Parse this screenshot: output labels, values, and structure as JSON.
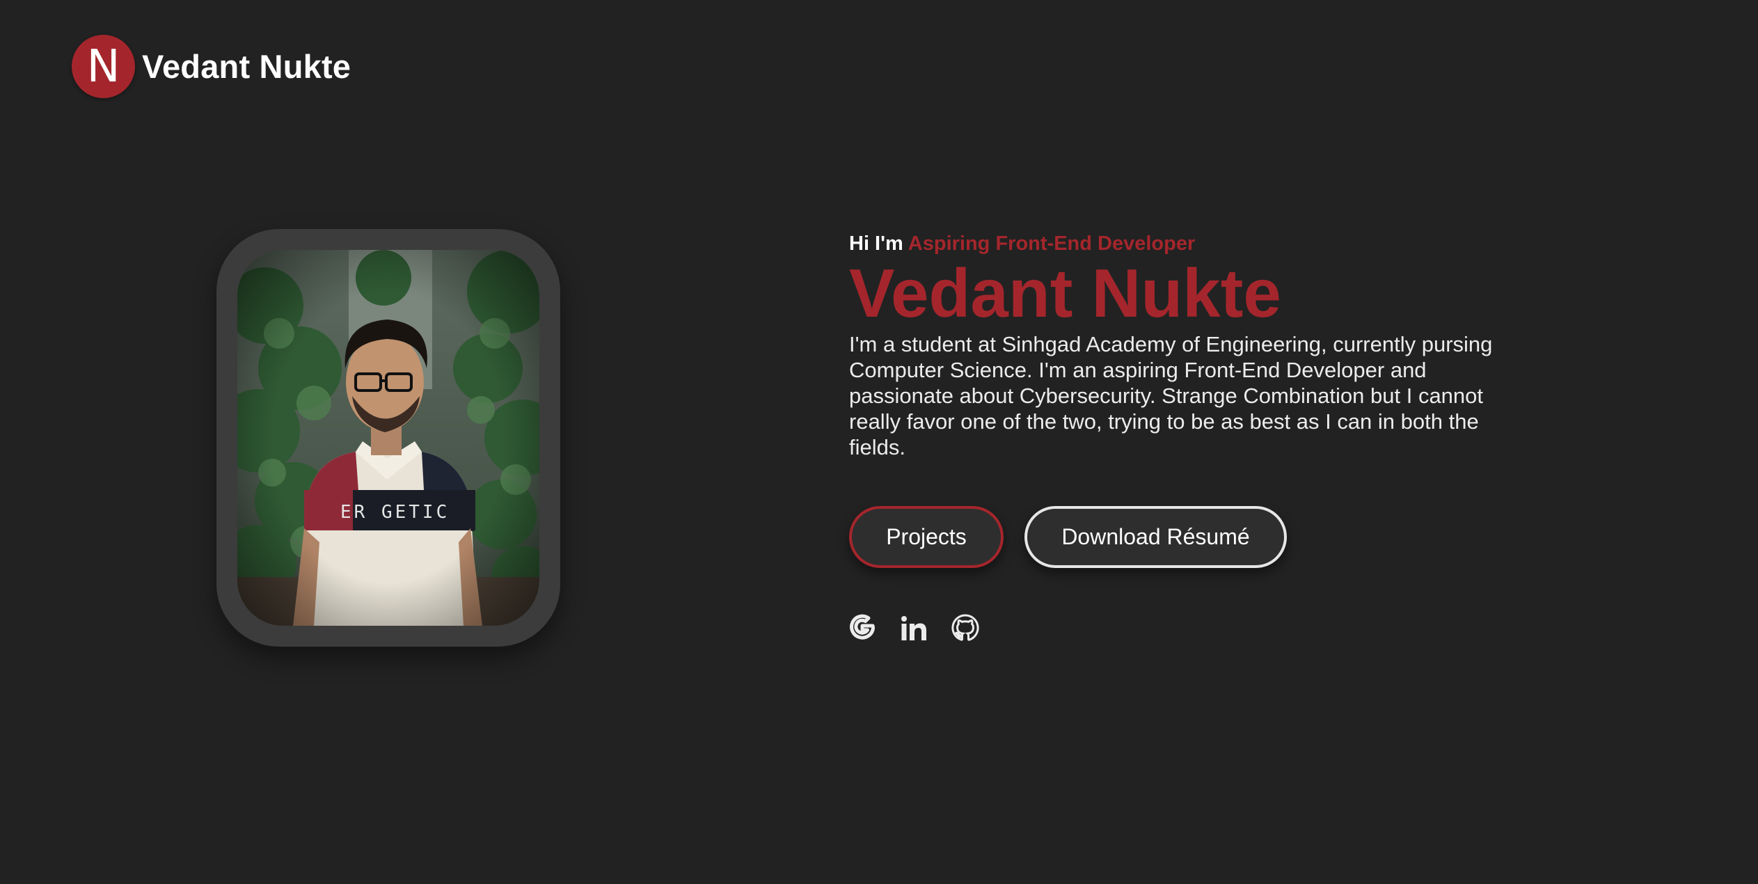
{
  "header": {
    "logo_letter": "N",
    "brand_name": "Vedant Nukte"
  },
  "hero": {
    "greeting": "Hi I'm",
    "role": "Aspiring Front-End Developer",
    "name": "Vedant Nukte",
    "bio": "I'm a student at Sinhgad Academy of Engineering, currently pursing Computer Science. I'm an aspiring Front-End Developer and passionate about Cybersecurity. Strange Combination but I cannot really favor one of the two, trying to be as best as I can in both the fields."
  },
  "buttons": {
    "projects_label": "Projects",
    "resume_label": "Download Résumé"
  },
  "socials": [
    {
      "icon": "google-icon"
    },
    {
      "icon": "linkedin-icon"
    },
    {
      "icon": "github-icon"
    }
  ],
  "colors": {
    "background": "#222222",
    "accent": "#a4262c",
    "text": "#ececec",
    "frame": "#3c3c3c"
  }
}
